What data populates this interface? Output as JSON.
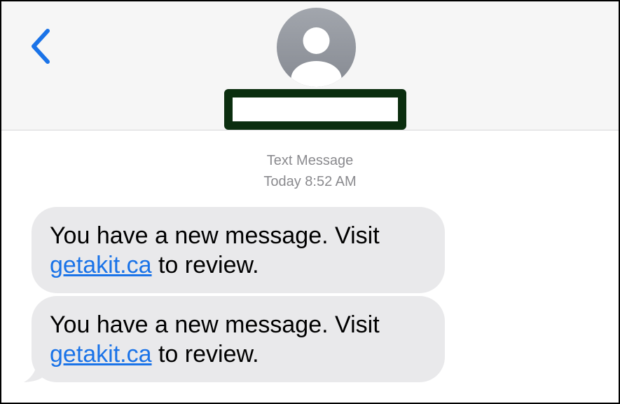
{
  "header": {
    "back_icon": "chevron-left-icon",
    "avatar_icon": "person-silhouette-icon",
    "contact_name": ""
  },
  "conversation": {
    "service_label": "Text Message",
    "timestamp": "Today 8:52 AM",
    "messages": [
      {
        "text_before": "You have a new message. Visit",
        "link": "getakit.ca",
        "text_after": " to review."
      },
      {
        "text_before": "You have a new message. Visit",
        "link": "getakit.ca",
        "text_after": " to review."
      }
    ]
  },
  "colors": {
    "accent": "#1a73e8",
    "header_bg": "#f6f6f6",
    "bubble_bg": "#e9e9eb",
    "redaction": "#0b2e0f",
    "meta_text": "#8a8a8e"
  }
}
